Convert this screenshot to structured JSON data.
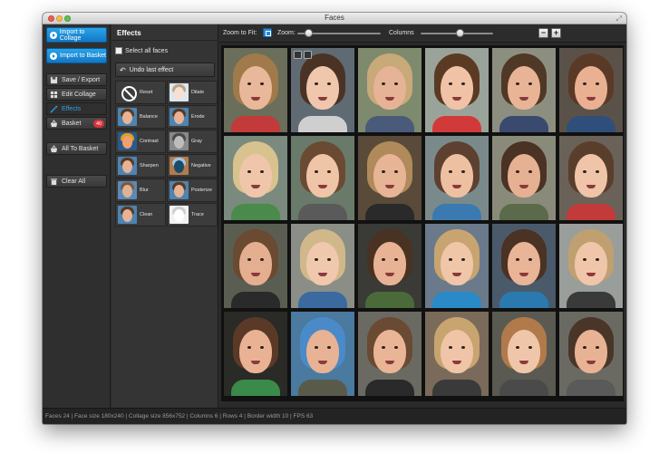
{
  "window": {
    "title": "Faces"
  },
  "sidebar": {
    "import_collage": "Import to Collage",
    "import_basket": "Import to Basket",
    "save_export": "Save / Export",
    "edit_collage": "Edit Collage",
    "effects": "Effects",
    "basket": "Basket",
    "basket_count": "40",
    "all_to_basket": "All To Basket",
    "clear_all": "Clear All"
  },
  "effects_panel": {
    "title": "Effects",
    "select_all": "Select all faces",
    "undo": "Undo last effect",
    "items": [
      {
        "label": "Reset",
        "icon": "reset-icon"
      },
      {
        "label": "Dilate",
        "tone": "light"
      },
      {
        "label": "Balance",
        "tone": "normal"
      },
      {
        "label": "Erode",
        "tone": "normal"
      },
      {
        "label": "Contrast",
        "tone": "contrast"
      },
      {
        "label": "Gray",
        "tone": "gray"
      },
      {
        "label": "Sharpen",
        "tone": "normal"
      },
      {
        "label": "Negative",
        "tone": "negative"
      },
      {
        "label": "Blur",
        "tone": "blur"
      },
      {
        "label": "Posterize",
        "tone": "normal"
      },
      {
        "label": "Clean",
        "tone": "normal"
      },
      {
        "label": "Trace",
        "tone": "trace"
      }
    ]
  },
  "toolbar": {
    "zoom_to_fit": "Zoom to Fit:",
    "zoom": "Zoom:",
    "columns": "Columns",
    "zoom_level": 0.1,
    "columns_level": 0.55,
    "minus": "−",
    "plus": "+"
  },
  "collage": {
    "selected_index": 1,
    "faces": [
      {
        "bg": "#6a6e5a",
        "hair": "#a07a4a",
        "skin": "#e9b79a",
        "shirt": "#c23a3a"
      },
      {
        "bg": "#5f6a72",
        "hair": "#4a3324",
        "skin": "#f0c6ac",
        "shirt": "#cfcfcf"
      },
      {
        "bg": "#7e8a6e",
        "hair": "#c8a978",
        "skin": "#e6b396",
        "shirt": "#4a5a7a"
      },
      {
        "bg": "#9aa39a",
        "hair": "#5a3a22",
        "skin": "#f0c2a6",
        "shirt": "#d23a3a"
      },
      {
        "bg": "#8c8f80",
        "hair": "#4f3826",
        "skin": "#e9b496",
        "shirt": "#3a4a6e"
      },
      {
        "bg": "#5a5248",
        "hair": "#5a3a26",
        "skin": "#e9b092",
        "shirt": "#2f4f7a"
      },
      {
        "bg": "#7a8a7e",
        "hair": "#d8c28e",
        "skin": "#efc6aa",
        "shirt": "#4a8a4a"
      },
      {
        "bg": "#6a7a6a",
        "hair": "#6a4a32",
        "skin": "#f0c4a6",
        "shirt": "#5a5a5a"
      },
      {
        "bg": "#5a4a3a",
        "hair": "#b08a5a",
        "skin": "#e8b496",
        "shirt": "#2a2a2a"
      },
      {
        "bg": "#7a8a8a",
        "hair": "#5e4030",
        "skin": "#eec0a2",
        "shirt": "#3a7ab0"
      },
      {
        "bg": "#8a8a7a",
        "hair": "#4a3224",
        "skin": "#e6b092",
        "shirt": "#5a6a4a"
      },
      {
        "bg": "#6a6258",
        "hair": "#5a3e2c",
        "skin": "#f0c4a8",
        "shirt": "#c23a3a"
      },
      {
        "bg": "#5a5e52",
        "hair": "#6a4a30",
        "skin": "#e4ae90",
        "shirt": "#2a2a2a"
      },
      {
        "bg": "#8a8e86",
        "hair": "#d0b88a",
        "skin": "#f0c8ae",
        "shirt": "#3a6aa0"
      },
      {
        "bg": "#3a3a36",
        "hair": "#4a3222",
        "skin": "#e8b294",
        "shirt": "#4a6a3a"
      },
      {
        "bg": "#6a7a8a",
        "hair": "#c8a470",
        "skin": "#f0c6a8",
        "shirt": "#2a8ac8"
      },
      {
        "bg": "#4a5a6a",
        "hair": "#4a3224",
        "skin": "#eab496",
        "shirt": "#2a7ab0"
      },
      {
        "bg": "#9a9e9a",
        "hair": "#c0a070",
        "skin": "#f0c6aa",
        "shirt": "#3a3a3a"
      },
      {
        "bg": "#2a2a26",
        "hair": "#5a3a26",
        "skin": "#eab294",
        "shirt": "#3a8a4a"
      },
      {
        "bg": "#4a7aa0",
        "hair": "#4a8ac8",
        "skin": "#e8b294",
        "shirt": "#5a5a4a"
      },
      {
        "bg": "#6a6a62",
        "hair": "#6a4a32",
        "skin": "#eab496",
        "shirt": "#2a2a2a"
      },
      {
        "bg": "#7a6a5a",
        "hair": "#c8a470",
        "skin": "#f0c4a6",
        "shirt": "#3a3a3a"
      },
      {
        "bg": "#5a5a52",
        "hair": "#b07a4a",
        "skin": "#f0c6aa",
        "shirt": "#4a4a4a"
      },
      {
        "bg": "#6a6a62",
        "hair": "#4a3628",
        "skin": "#e8b294",
        "shirt": "#5a5a5a"
      }
    ]
  },
  "status": {
    "text": "Faces 24 | Face size 180x240 | Collage size 856x752 | Columns 6 | Rows 4 | Border width 10 | FPS 63"
  }
}
